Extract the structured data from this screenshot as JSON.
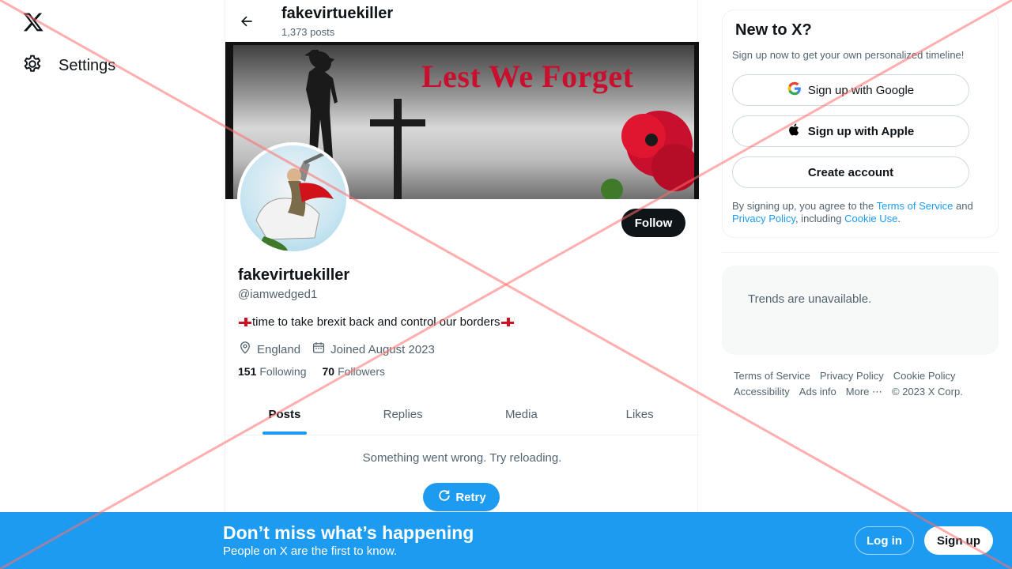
{
  "nav": {
    "settings_label": "Settings"
  },
  "header": {
    "name": "fakevirtuekiller",
    "posts_count": "1,373 posts"
  },
  "banner": {
    "text": "Lest We Forget"
  },
  "profile": {
    "follow_label": "Follow",
    "name": "fakevirtuekiller",
    "handle": "@iamwedged1",
    "bio": "time to take brexit back and control our borders",
    "location": "England",
    "joined": "Joined August 2023",
    "following_count": "151",
    "following_label": "Following",
    "followers_count": "70",
    "followers_label": "Followers"
  },
  "tabs": [
    {
      "label": "Posts",
      "active": true
    },
    {
      "label": "Replies",
      "active": false
    },
    {
      "label": "Media",
      "active": false
    },
    {
      "label": "Likes",
      "active": false
    }
  ],
  "feed": {
    "error": "Something went wrong. Try reloading.",
    "retry_label": "Retry"
  },
  "signup": {
    "title": "New to X?",
    "subtitle": "Sign up now to get your own personalized timeline!",
    "google_label": "Sign up with Google",
    "apple_label": "Sign up with Apple",
    "create_label": "Create account",
    "legal_prefix": "By signing up, you agree to the ",
    "terms_link": "Terms of Service",
    "legal_and": " and ",
    "privacy_link": "Privacy Policy",
    "legal_including": ", including ",
    "cookie_link": "Cookie Use",
    "legal_end": "."
  },
  "trends": {
    "message": "Trends are unavailable."
  },
  "footer": {
    "links": [
      "Terms of Service",
      "Privacy Policy",
      "Cookie Policy",
      "Accessibility",
      "Ads info",
      "More ⋯",
      "© 2023 X Corp."
    ]
  },
  "bottom_banner": {
    "title": "Don’t miss what’s happening",
    "subtitle": "People on X are the first to know.",
    "login_label": "Log in",
    "signup_label": "Sign up"
  },
  "colors": {
    "accent": "#1d9bf0",
    "text": "#0f1419",
    "muted": "#536471",
    "overlay_cross": "#ff6b6b"
  }
}
